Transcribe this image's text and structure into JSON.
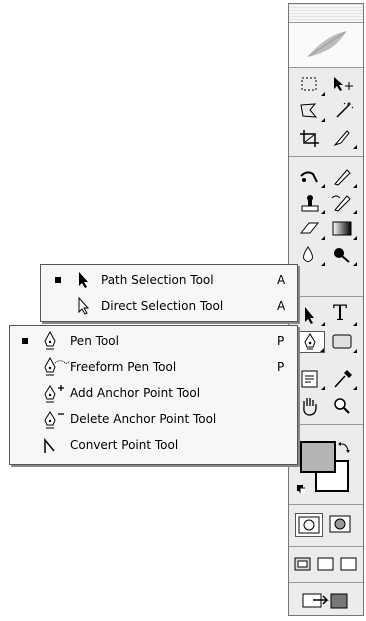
{
  "path_menu": {
    "items": [
      {
        "label": "Path Selection Tool",
        "shortcut": "A",
        "selected": true,
        "icon": "arrow-black-icon"
      },
      {
        "label": "Direct Selection Tool",
        "shortcut": "A",
        "selected": false,
        "icon": "arrow-white-icon"
      }
    ]
  },
  "pen_menu": {
    "items": [
      {
        "label": "Pen Tool",
        "shortcut": "P",
        "selected": true,
        "icon": "pen-icon"
      },
      {
        "label": "Freeform Pen Tool",
        "shortcut": "P",
        "selected": false,
        "icon": "freeform-pen-icon"
      },
      {
        "label": "Add Anchor Point Tool",
        "shortcut": "",
        "selected": false,
        "icon": "add-anchor-icon"
      },
      {
        "label": "Delete Anchor Point Tool",
        "shortcut": "",
        "selected": false,
        "icon": "delete-anchor-icon"
      },
      {
        "label": "Convert Point Tool",
        "shortcut": "",
        "selected": false,
        "icon": "convert-point-icon"
      }
    ]
  },
  "palette": {
    "type_tool_glyph": "T",
    "colors": {
      "foreground": "#b4b4b4",
      "background": "#ffffff"
    }
  }
}
